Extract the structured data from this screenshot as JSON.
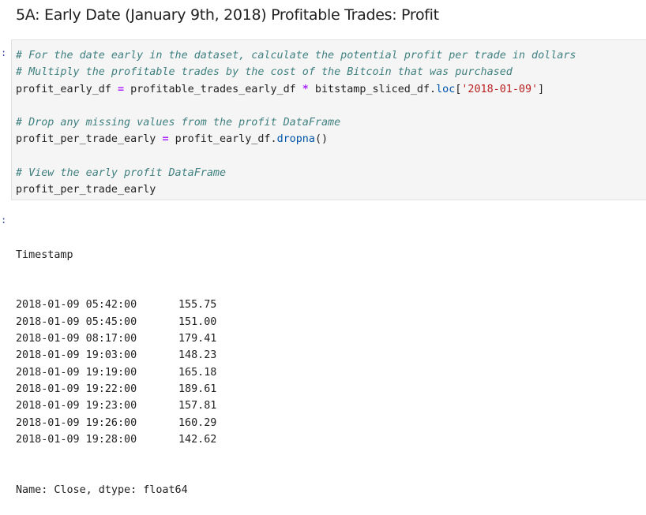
{
  "heading": "5A: Early Date (January 9th, 2018) Profitable Trades: Profit",
  "code_cell": {
    "comment1": "# For the date early in the dataset, calculate the potential profit per trade in dollars",
    "comment2": "# Multiply the profitable trades by the cost of the Bitcoin that was purchased",
    "line3_var": "profit_early_df",
    "line3_eq": "=",
    "line3_a": "profitable_trades_early_df",
    "line3_mul": "*",
    "line3_b": "bitstamp_sliced_df.",
    "line3_attr": "loc",
    "line3_open": "[",
    "line3_str": "'2018-01-09'",
    "line3_close": "]",
    "comment3": "# Drop any missing values from the profit DataFrame",
    "line6_var": "profit_per_trade_early",
    "line6_eq": "=",
    "line6_obj": "profit_early_df.",
    "line6_attr": "dropna",
    "line6_call": "()",
    "comment4": "# View the early profit DataFrame",
    "line9": "profit_per_trade_early"
  },
  "output": {
    "index_name": "Timestamp",
    "rows": [
      {
        "ts": "2018-01-09 05:42:00",
        "val": "155.75"
      },
      {
        "ts": "2018-01-09 05:45:00",
        "val": "151.00"
      },
      {
        "ts": "2018-01-09 08:17:00",
        "val": "179.41"
      },
      {
        "ts": "2018-01-09 19:03:00",
        "val": "148.23"
      },
      {
        "ts": "2018-01-09 19:19:00",
        "val": "165.18"
      },
      {
        "ts": "2018-01-09 19:22:00",
        "val": "189.61"
      },
      {
        "ts": "2018-01-09 19:23:00",
        "val": "157.81"
      },
      {
        "ts": "2018-01-09 19:26:00",
        "val": "160.29"
      },
      {
        "ts": "2018-01-09 19:28:00",
        "val": "142.62"
      }
    ],
    "footer": "Name: Close, dtype: float64"
  },
  "prompt_marks": [
    ":",
    ":"
  ]
}
